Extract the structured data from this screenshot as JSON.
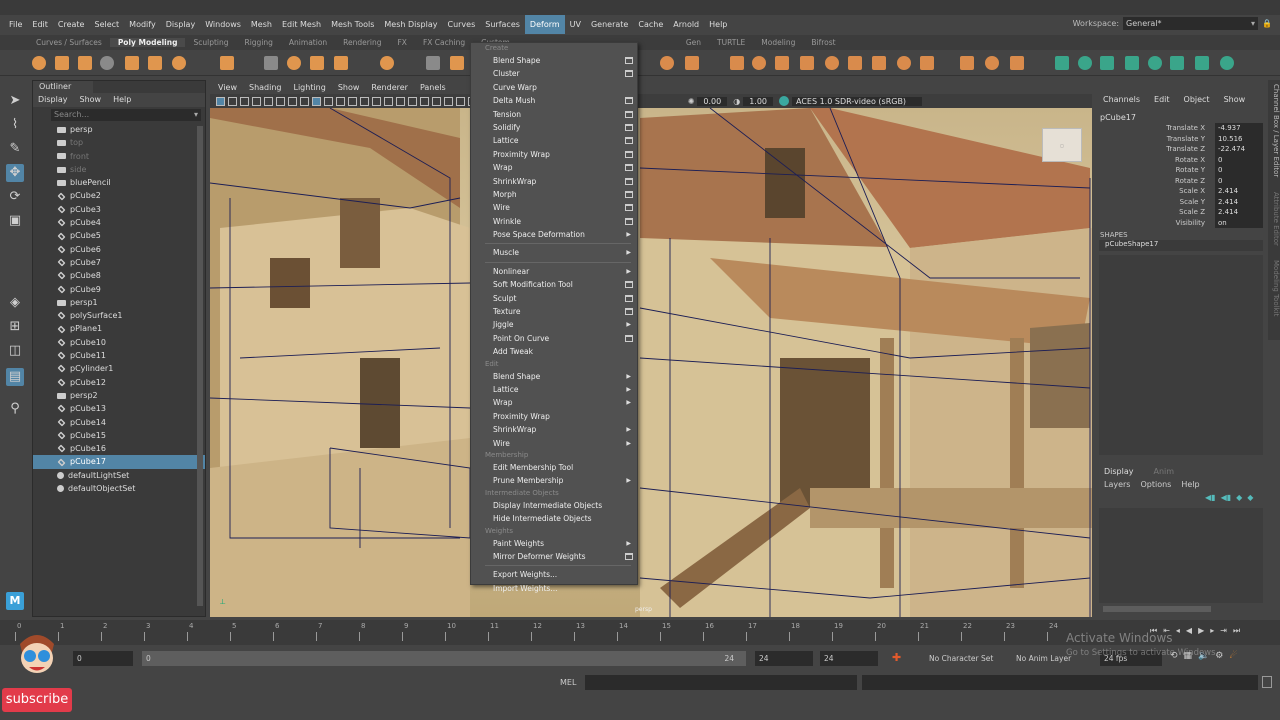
{
  "menubar": {
    "items": [
      "File",
      "Edit",
      "Create",
      "Select",
      "Modify",
      "Display",
      "Windows",
      "Mesh",
      "Edit Mesh",
      "Mesh Tools",
      "Mesh Display",
      "Curves",
      "Surfaces",
      "Deform",
      "UV",
      "Generate",
      "Cache",
      "Arnold",
      "Help"
    ],
    "active": "Deform"
  },
  "workspace": {
    "label": "Workspace:",
    "value": "General*"
  },
  "shelf": {
    "tabs": [
      "Curves / Surfaces",
      "Poly Modeling",
      "Sculpting",
      "Rigging",
      "Animation",
      "Rendering",
      "FX",
      "FX Caching",
      "Custom",
      "Gen",
      "TURTLE",
      "Modeling",
      "Bifrost"
    ],
    "active": "Poly Modeling"
  },
  "outliner": {
    "title": "Outliner",
    "menu": [
      "Display",
      "Show",
      "Help"
    ],
    "search_placeholder": "Search...",
    "items": [
      {
        "n": "persp",
        "t": "cam"
      },
      {
        "n": "top",
        "t": "cam",
        "dim": true
      },
      {
        "n": "front",
        "t": "cam",
        "dim": true
      },
      {
        "n": "side",
        "t": "cam",
        "dim": true
      },
      {
        "n": "bluePencil",
        "t": "pencil"
      },
      {
        "n": "pCube2",
        "t": "mesh"
      },
      {
        "n": "pCube3",
        "t": "mesh"
      },
      {
        "n": "pCube4",
        "t": "mesh"
      },
      {
        "n": "pCube5",
        "t": "mesh"
      },
      {
        "n": "pCube6",
        "t": "mesh"
      },
      {
        "n": "pCube7",
        "t": "mesh"
      },
      {
        "n": "pCube8",
        "t": "mesh"
      },
      {
        "n": "pCube9",
        "t": "mesh"
      },
      {
        "n": "persp1",
        "t": "cam"
      },
      {
        "n": "polySurface1",
        "t": "mesh"
      },
      {
        "n": "pPlane1",
        "t": "mesh"
      },
      {
        "n": "pCube10",
        "t": "mesh"
      },
      {
        "n": "pCube11",
        "t": "mesh"
      },
      {
        "n": "pCylinder1",
        "t": "mesh"
      },
      {
        "n": "pCube12",
        "t": "mesh"
      },
      {
        "n": "persp2",
        "t": "cam"
      },
      {
        "n": "pCube13",
        "t": "mesh"
      },
      {
        "n": "pCube14",
        "t": "mesh"
      },
      {
        "n": "pCube15",
        "t": "mesh"
      },
      {
        "n": "pCube16",
        "t": "mesh"
      },
      {
        "n": "pCube17",
        "t": "mesh",
        "sel": true
      },
      {
        "n": "defaultLightSet",
        "t": "set"
      },
      {
        "n": "defaultObjectSet",
        "t": "set"
      }
    ]
  },
  "viewport": {
    "menu": [
      "View",
      "Shading",
      "Lighting",
      "Show",
      "Renderer",
      "Panels"
    ],
    "exposure": "0.00",
    "gamma": "1.00",
    "color_space": "ACES 1.0 SDR-video (sRGB)",
    "camera_label": "persp"
  },
  "deform_menu": [
    {
      "h": "Create"
    },
    {
      "l": "Blend Shape",
      "s": "box"
    },
    {
      "l": "Cluster",
      "s": "box"
    },
    {
      "l": "Curve Warp"
    },
    {
      "l": "Delta Mush",
      "s": "box"
    },
    {
      "l": "Tension",
      "s": "box"
    },
    {
      "l": "Solidify",
      "s": "box"
    },
    {
      "l": "Lattice",
      "s": "box"
    },
    {
      "l": "Proximity Wrap",
      "s": "box"
    },
    {
      "l": "Wrap",
      "s": "box"
    },
    {
      "l": "ShrinkWrap",
      "s": "box"
    },
    {
      "l": "Morph",
      "s": "box"
    },
    {
      "l": "Wire",
      "s": "box"
    },
    {
      "l": "Wrinkle",
      "s": "box"
    },
    {
      "l": "Pose Space Deformation",
      "s": "arrow"
    },
    {
      "sep": true
    },
    {
      "l": "Muscle",
      "s": "arrow"
    },
    {
      "sep": true
    },
    {
      "l": "Nonlinear",
      "s": "arrow"
    },
    {
      "l": "Soft Modification Tool",
      "s": "box"
    },
    {
      "l": "Sculpt",
      "s": "box"
    },
    {
      "l": "Texture",
      "s": "box"
    },
    {
      "l": "Jiggle",
      "s": "arrow"
    },
    {
      "l": "Point On Curve",
      "s": "box"
    },
    {
      "l": "Add Tweak"
    },
    {
      "h": "Edit"
    },
    {
      "l": "Blend Shape",
      "s": "arrow"
    },
    {
      "l": "Lattice",
      "s": "arrow"
    },
    {
      "l": "Wrap",
      "s": "arrow"
    },
    {
      "l": "Proximity Wrap"
    },
    {
      "l": "ShrinkWrap",
      "s": "arrow"
    },
    {
      "l": "Wire",
      "s": "arrow"
    },
    {
      "h": "Membership"
    },
    {
      "l": "Edit Membership Tool"
    },
    {
      "l": "Prune Membership",
      "s": "arrow"
    },
    {
      "h": "Intermediate Objects"
    },
    {
      "l": "Display Intermediate Objects"
    },
    {
      "l": "Hide Intermediate Objects"
    },
    {
      "h": "Weights"
    },
    {
      "l": "Paint Weights",
      "s": "arrow"
    },
    {
      "l": "Mirror Deformer Weights",
      "s": "box"
    },
    {
      "sep": true
    },
    {
      "l": "Export Weights..."
    },
    {
      "l": "Import Weights..."
    }
  ],
  "channel_box": {
    "menu": [
      "Channels",
      "Edit",
      "Object",
      "Show"
    ],
    "object": "pCube17",
    "attrs": [
      {
        "l": "Translate X",
        "v": "-4.937"
      },
      {
        "l": "Translate Y",
        "v": "10.516"
      },
      {
        "l": "Translate Z",
        "v": "-22.474"
      },
      {
        "l": "Rotate X",
        "v": "0"
      },
      {
        "l": "Rotate Y",
        "v": "0"
      },
      {
        "l": "Rotate Z",
        "v": "0"
      },
      {
        "l": "Scale X",
        "v": "2.414"
      },
      {
        "l": "Scale Y",
        "v": "2.414"
      },
      {
        "l": "Scale Z",
        "v": "2.414"
      },
      {
        "l": "Visibility",
        "v": "on"
      }
    ],
    "shapes_label": "SHAPES",
    "shape": "pCubeShape17",
    "layer_tabs": [
      "Display",
      "Anim"
    ],
    "layer_menu": [
      "Layers",
      "Options",
      "Help"
    ]
  },
  "side_tabs": [
    "Channel Box / Layer Editor",
    "Attribute Editor",
    "Modeling Toolkit"
  ],
  "timeline": {
    "ticks": [
      "0",
      "1",
      "2",
      "3",
      "4",
      "5",
      "6",
      "7",
      "8",
      "9",
      "10",
      "11",
      "12",
      "13",
      "14",
      "15",
      "16",
      "17",
      "18",
      "19",
      "20",
      "21",
      "22",
      "23",
      "24"
    ]
  },
  "range": {
    "start": "0",
    "inner_start": "0",
    "inner_end": "24",
    "end1": "24",
    "end2": "24",
    "character_set": "No Character Set",
    "anim_layer": "No Anim Layer",
    "fps": "24 fps"
  },
  "command": {
    "label": "MEL"
  },
  "overlay": {
    "subscribe": "subscribe",
    "watermark_title": "Activate Windows",
    "watermark_sub": "Go to Settings to activate Windows."
  }
}
